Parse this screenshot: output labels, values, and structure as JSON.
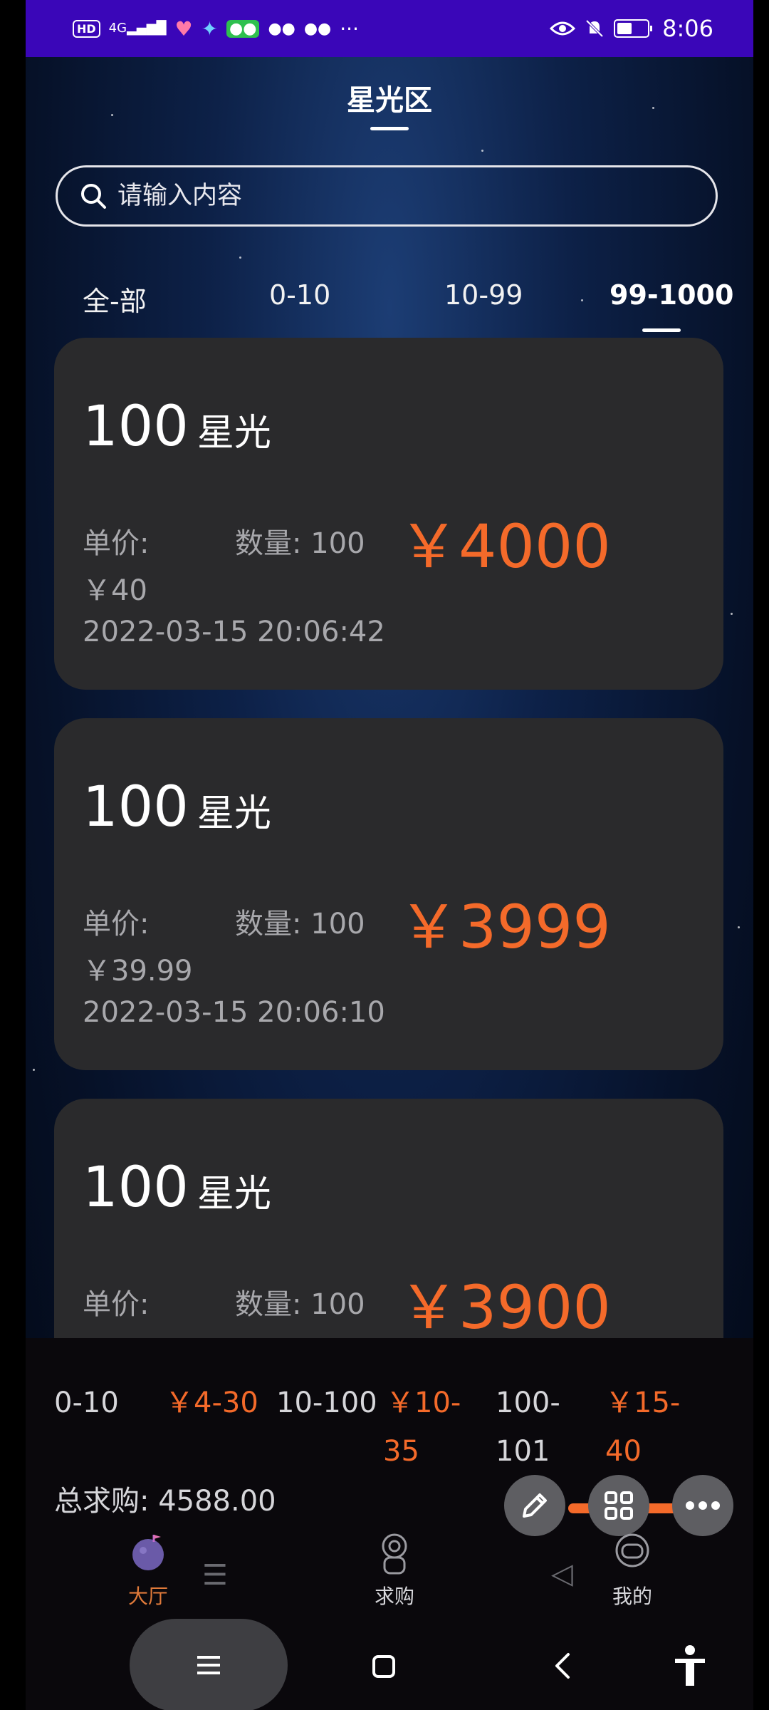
{
  "status_bar": {
    "left_icons": [
      "hd-icon",
      "signal-4g-icon",
      "heart-icon",
      "broom-icon",
      "wechat-icon",
      "wechat-icon",
      "wechat-icon",
      "more-notifications-icon"
    ],
    "hd": "HD",
    "network": "4G",
    "overflow": "···",
    "time": "8:06",
    "right_icons": [
      "eye-icon",
      "mute-bell-icon",
      "battery-icon"
    ]
  },
  "header": {
    "title": "星光区"
  },
  "search": {
    "placeholder": "请输入内容"
  },
  "tabs": [
    {
      "label": "全-部",
      "active": false
    },
    {
      "label": "0-10",
      "active": false
    },
    {
      "label": "10-99",
      "active": false
    },
    {
      "label": "99-1000",
      "active": true
    }
  ],
  "listings": [
    {
      "amount": "100",
      "unit": "星光",
      "unit_price_label": "单价:",
      "qty_label": "数量: 100",
      "total": "￥4000",
      "unit_price": "￥40",
      "time": "2022-03-15 20:06:42"
    },
    {
      "amount": "100",
      "unit": "星光",
      "unit_price_label": "单价:",
      "qty_label": "数量: 100",
      "total": "￥3999",
      "unit_price": "￥39.99",
      "time": "2022-03-15 20:06:10"
    },
    {
      "amount": "100",
      "unit": "星光",
      "unit_price_label": "单价:",
      "qty_label": "数量: 100",
      "total": "￥3900",
      "unit_price": "",
      "time": ""
    }
  ],
  "summary": {
    "ranges": [
      {
        "range": "0-10",
        "price": "￥4-30"
      },
      {
        "range": "10-100",
        "price_line1": "￥10-",
        "price_line2": "35"
      },
      {
        "range_line1": "100-",
        "range_line2": "101",
        "price_line1": "￥15-",
        "price_line2": "40"
      }
    ],
    "total": "总求购: 4588.00"
  },
  "floating_actions": [
    "pencil-icon",
    "grid-icon",
    "more-icon"
  ],
  "bottom_nav": [
    {
      "label": "大厅",
      "icon": "planet-icon",
      "active": true
    },
    {
      "label": "求购",
      "icon": "astronaut-icon",
      "active": false
    },
    {
      "label": "我的",
      "icon": "helmet-icon",
      "active": false
    }
  ],
  "colors": {
    "accent": "#f46a2a",
    "status_bar": "#3a06b8",
    "card": "#2a2a2c"
  }
}
